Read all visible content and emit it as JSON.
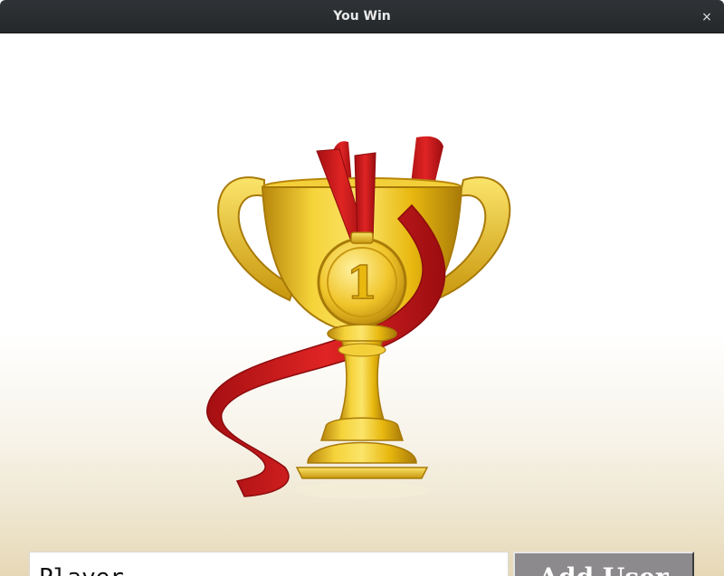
{
  "window": {
    "title": "You Win",
    "close_symbol": "×"
  },
  "trophy": {
    "medal_number": "1",
    "icon": "trophy-with-medal-icon"
  },
  "form": {
    "name_value": "Player",
    "add_button_label": "Add User"
  },
  "colors": {
    "titlebar": "#2b2f32",
    "gold": "#e8b80f",
    "ribbon": "#d01a1a",
    "button": "#8c8a8c"
  }
}
